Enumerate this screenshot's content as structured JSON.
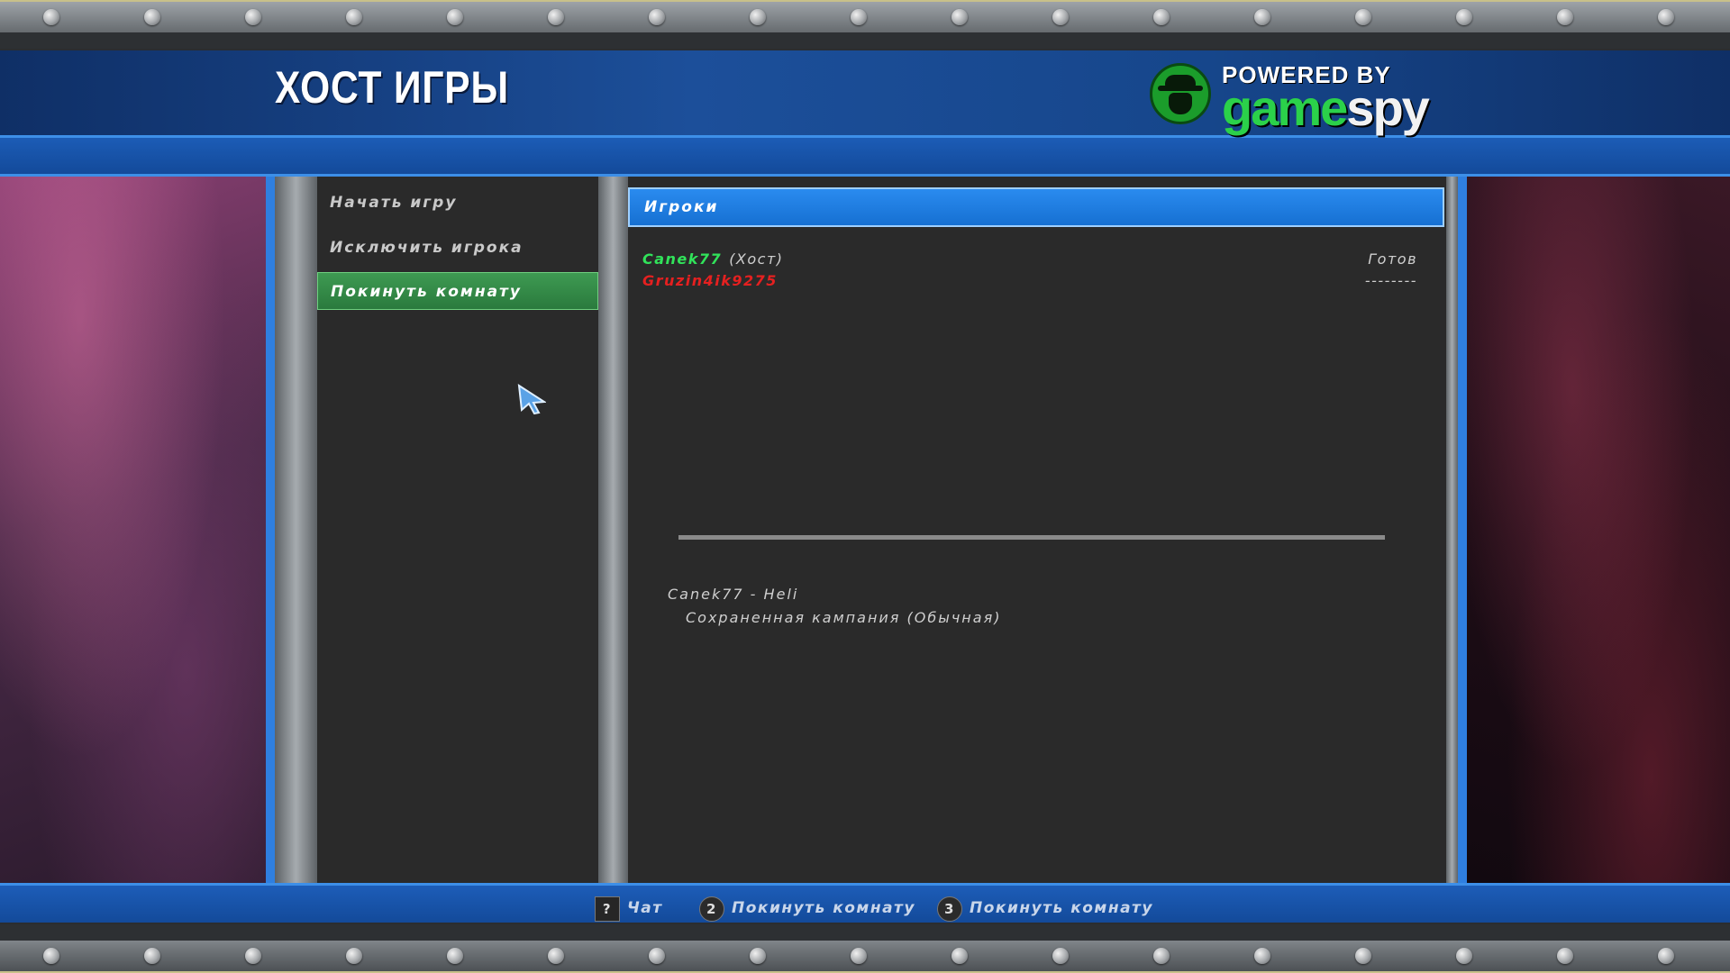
{
  "header": {
    "title": "ХОСТ ИГРЫ",
    "powered_by": "POWERED BY",
    "brand_game": "game",
    "brand_spy": "spy"
  },
  "menu": {
    "items": [
      {
        "label": "Начать игру"
      },
      {
        "label": "Исключить игрока"
      },
      {
        "label": "Покинуть комнату",
        "selected": true
      }
    ]
  },
  "players": {
    "header": "Игроки",
    "rows": [
      {
        "name": "Canek77",
        "tag": "(Хост)",
        "status": "Готов",
        "color": "#31e35a"
      },
      {
        "name": "Gruzin4ik9275",
        "tag": "",
        "status": "--------",
        "color": "#e52020"
      }
    ]
  },
  "game_info": {
    "line1": "Canek77 - Heli",
    "line2": "Сохраненная кампания (Обычная)"
  },
  "footer": {
    "hints": [
      {
        "key": "?",
        "label": "Чат"
      },
      {
        "key": "2",
        "label": "Покинуть комнату"
      },
      {
        "key": "3",
        "label": "Покинуть комнату"
      }
    ]
  },
  "icons": {
    "cursor": "cursor-arrow-icon",
    "brand": "gamespy-spy-icon"
  },
  "colors": {
    "accent_blue": "#2a8bef",
    "selected_green": "#3e9a52"
  }
}
